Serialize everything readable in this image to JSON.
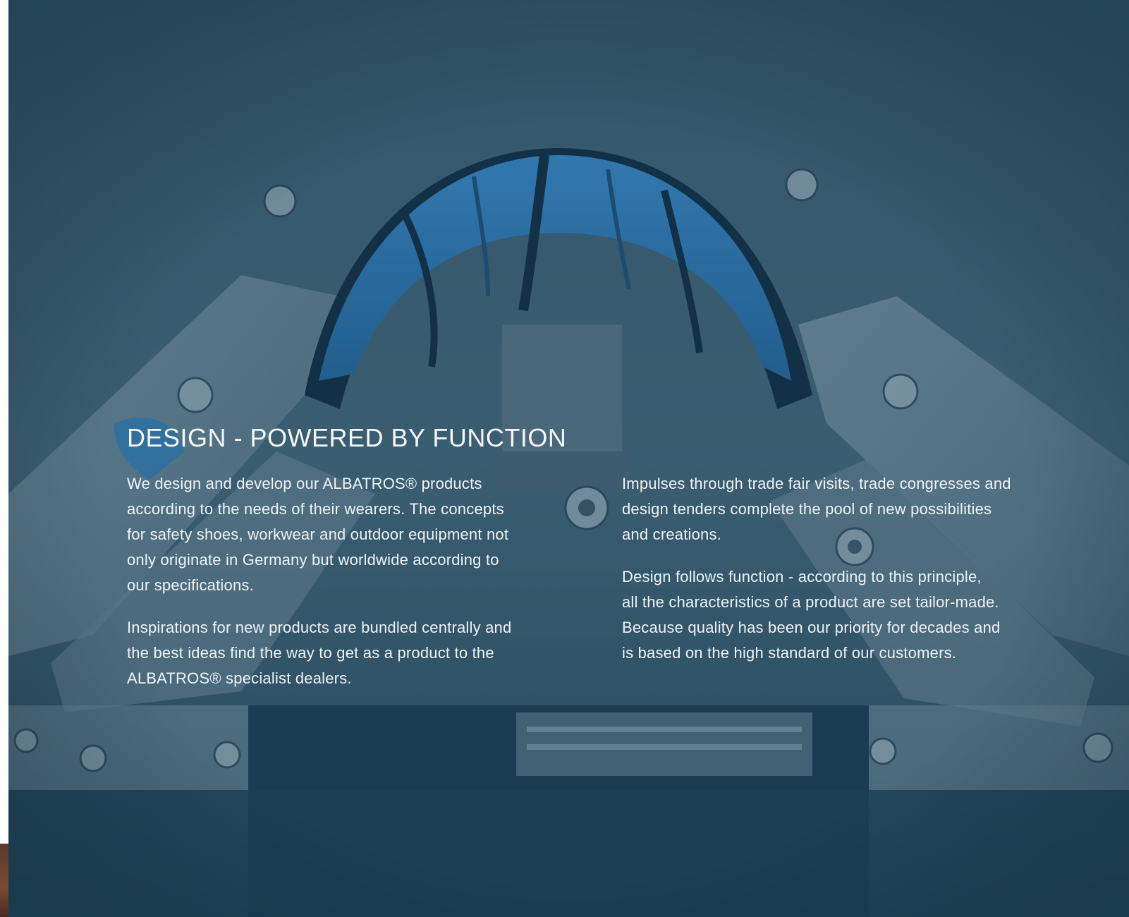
{
  "section": {
    "heading": "DESIGN - POWERED BY FUNCTION",
    "left_paragraphs": [
      "We design and develop our ALBATROS® products\naccording to the needs of their wearers. The concepts\nfor safety shoes, workwear and outdoor equipment not\nonly originate in Germany but worldwide according to\nour specifications.",
      "Inspirations for new products are bundled centrally and\nthe best ideas find the way to get as a product to the\nALBATROS® specialist dealers."
    ],
    "right_paragraphs": [
      "Impulses through trade fair visits, trade congresses and\ndesign tenders complete the pool of new possibilities\nand creations.",
      "Design follows function - according to this principle,\nall the characteristics of a product are set tailor-made.\nBecause quality has been our priority for decades and\nis based on the high standard of our customers."
    ]
  },
  "background": {
    "overlay_color": "#2e5a73",
    "sole_color": "#2f7fc0",
    "metal_color": "#7f98a6"
  }
}
